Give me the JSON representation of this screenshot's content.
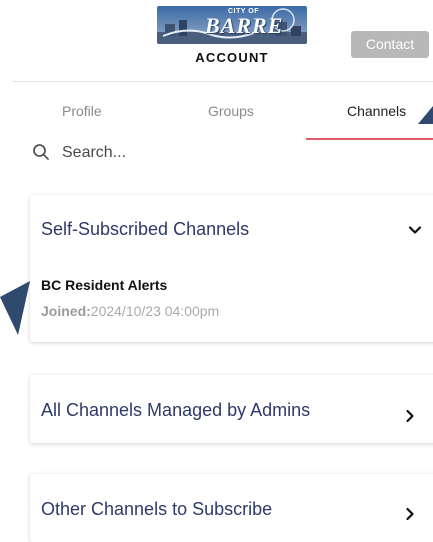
{
  "header": {
    "logo_city": "CITY OF",
    "logo_name": "BARRE",
    "title": "ACCOUNT",
    "contact_label": "Contact"
  },
  "tabs": [
    {
      "label": "Profile",
      "active": false
    },
    {
      "label": "Groups",
      "active": false
    },
    {
      "label": "Channels",
      "active": true
    }
  ],
  "search": {
    "placeholder": "Search...",
    "value": ""
  },
  "sections": {
    "self_subscribed": {
      "title": "Self-Subscribed Channels",
      "expanded": true,
      "items": [
        {
          "name": "BC Resident Alerts",
          "joined_label": "Joined:",
          "joined_value": "2024/10/23 04:00pm"
        }
      ]
    },
    "admin_managed": {
      "title": "All Channels Managed by Admins",
      "expanded": false
    },
    "other": {
      "title": "Other Channels to Subscribe",
      "expanded": false
    }
  },
  "colors": {
    "accent_underline": "#e05a66",
    "section_title": "#2e3a68",
    "pointer_arrow": "#2f4a6e",
    "contact_button": "#b8b8b8"
  },
  "icons": {
    "search": "search-icon",
    "expanded": "chevron-down-icon",
    "collapsed": "chevron-right-icon",
    "annotation": "pointer-arrow-icon"
  }
}
